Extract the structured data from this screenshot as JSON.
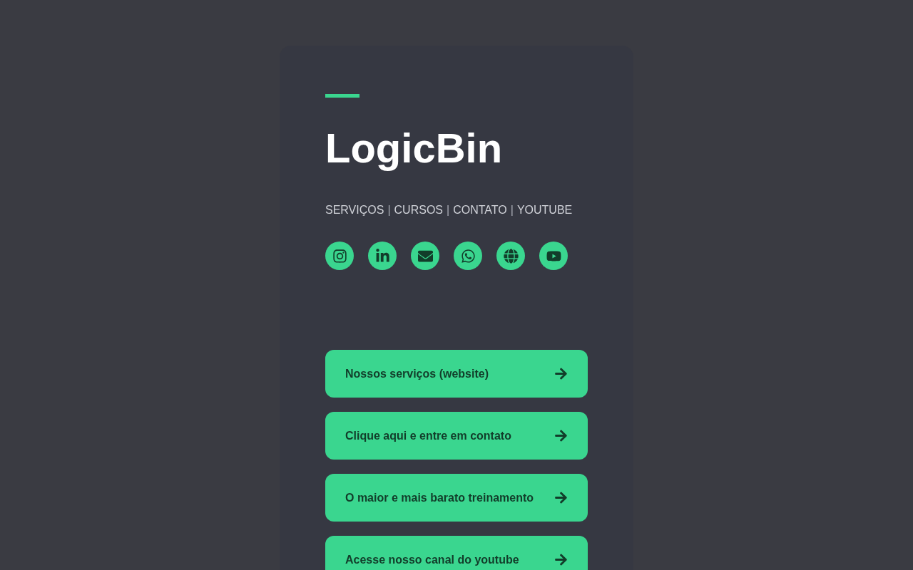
{
  "profile": {
    "title": "LogicBin"
  },
  "nav": [
    {
      "kind": "link",
      "label": "SERVIÇOS"
    },
    {
      "kind": "separator",
      "label": "|"
    },
    {
      "kind": "link",
      "label": "CURSOS"
    },
    {
      "kind": "separator",
      "label": "|"
    },
    {
      "kind": "link",
      "label": "CONTATO"
    },
    {
      "kind": "separator",
      "label": "|"
    },
    {
      "kind": "link",
      "label": "YOUTUBE"
    }
  ],
  "social": [
    {
      "kind": "instagram"
    },
    {
      "kind": "linkedin"
    },
    {
      "kind": "email"
    },
    {
      "kind": "whatsapp"
    },
    {
      "kind": "globe"
    },
    {
      "kind": "youtube"
    }
  ],
  "links": [
    {
      "label": "Nossos serviços (website)"
    },
    {
      "label": "Clique aqui e entre em contato"
    },
    {
      "label": "O maior e mais barato treinamento"
    },
    {
      "label": "Acesse nosso canal do youtube"
    }
  ]
}
